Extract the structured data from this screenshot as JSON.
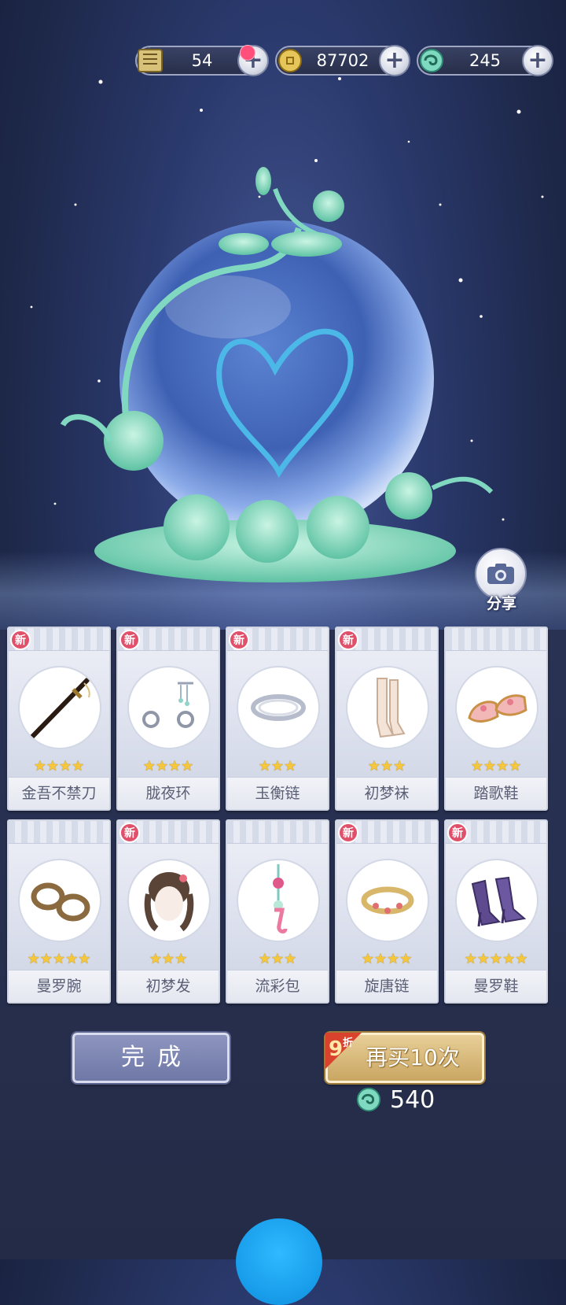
{
  "currencies": [
    {
      "id": "tickets",
      "value": "54",
      "icon": "scroll-icon",
      "has_badge": true
    },
    {
      "id": "coins",
      "value": "87702",
      "icon": "coin-icon"
    },
    {
      "id": "jade",
      "value": "245",
      "icon": "jade-swirl-icon"
    }
  ],
  "share": {
    "label": "分享"
  },
  "items": [
    {
      "name": "金吾不禁刀",
      "stars": 4,
      "is_new": true,
      "icon": "sword-icon"
    },
    {
      "name": "胧夜环",
      "stars": 4,
      "is_new": true,
      "icon": "earrings-icon"
    },
    {
      "name": "玉衡链",
      "stars": 3,
      "is_new": true,
      "icon": "necklace-icon"
    },
    {
      "name": "初梦袜",
      "stars": 3,
      "is_new": true,
      "icon": "socks-icon"
    },
    {
      "name": "踏歌鞋",
      "stars": 4,
      "is_new": false,
      "icon": "shoes-icon"
    },
    {
      "name": "曼罗腕",
      "stars": 5,
      "is_new": false,
      "icon": "bracelet-icon"
    },
    {
      "name": "初梦发",
      "stars": 3,
      "is_new": true,
      "icon": "hair-icon"
    },
    {
      "name": "流彩包",
      "stars": 3,
      "is_new": false,
      "icon": "pendant-icon"
    },
    {
      "name": "旋唐链",
      "stars": 4,
      "is_new": true,
      "icon": "anklet-icon"
    },
    {
      "name": "曼罗鞋",
      "stars": 5,
      "is_new": true,
      "icon": "heels-icon"
    }
  ],
  "new_tag": "新",
  "done_button": "完成",
  "buy_again": {
    "label": "再买10次",
    "discount_num": "9",
    "discount_unit": "折",
    "cost": "540"
  }
}
